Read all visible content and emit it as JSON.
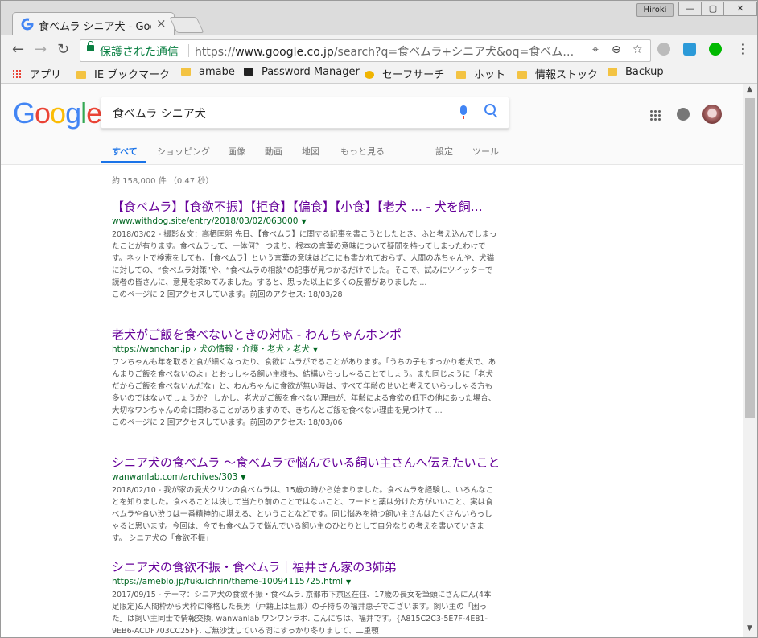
{
  "window": {
    "tab_title": "食べムラ シニア犬 - Goo",
    "profile": "Hiroki",
    "min": "—",
    "max": "▢",
    "close": "✕"
  },
  "toolbar": {
    "back": "←",
    "forward": "→",
    "reload": "C",
    "secure_label": "保護された通信",
    "url_scheme": "https://",
    "url_host": "www.google.co.jp",
    "url_rest": "/search?q=食べムラ+シニア犬&oq=食べム…",
    "menu": "⋮"
  },
  "bookmarks": [
    {
      "label": "アプリ"
    },
    {
      "label": "IE ブックマーク"
    },
    {
      "label": "amabe"
    },
    {
      "label": "Password Manager"
    },
    {
      "label": "セーフサーチ"
    },
    {
      "label": "ホット"
    },
    {
      "label": "情報ストック"
    },
    {
      "label": "Backup"
    }
  ],
  "google": {
    "logo": [
      "G",
      "o",
      "o",
      "g",
      "l",
      "e"
    ],
    "logo_colors": [
      "#4285f4",
      "#ea4335",
      "#fbbc05",
      "#4285f4",
      "#34a853",
      "#ea4335"
    ],
    "query": "食べムラ シニア犬",
    "tabs": [
      "すべて",
      "ショッピング",
      "画像",
      "動画",
      "地図",
      "もっと見る"
    ],
    "tools": [
      "設定",
      "ツール"
    ],
    "stats": "約 158,000 件 （0.47 秒）"
  },
  "results": [
    {
      "title": "【食べムラ】【食欲不振】【拒食】【偏食】【小食】【老犬 ... - 犬を飼…",
      "url": "www.withdog.site/entry/2018/03/02/063000",
      "snippet": "2018/03/02 - 撮影＆文：高栖匡躬 先日、【食べムラ】に関する記事を書こうとしたとき、ふと考え込んでしまったことが有ります。食べムラって、一体何？ つまり、根本の言葉の意味について疑問を持ってしまったわけです。ネットで検索をしても、【食べムラ】という言葉の意味はどこにも書かれておらず、人間の赤ちゃんや、犬猫に対しての、“食べムラ対策”や、“食べムラの相談”の記事が見つかるだけでした。そこで、試みにツイッターで読者の皆さんに、意見を求めてみました。すると、思った以上に多くの反響がありました ...",
      "visited": "このページに 2 回アクセスしています。前回のアクセス: 18/03/28"
    },
    {
      "title": "老犬がご飯を食べないときの対応 - わんちゃんホンポ",
      "url": "https://wanchan.jp › 犬の情報 › 介護・老犬 › 老犬",
      "snippet": "ワンちゃんも年を取ると食が細くなったり、食欲にムラがでることがあります。「うちの子もすっかり老犬で、あんまりご飯を食べないのよ」とおっしゃる飼い主様も、結構いらっしゃることでしょう。また同じように「老犬だからご飯を食べないんだな」と、わんちゃんに食欲が無い時は、すべて年齢のせいと考えていらっしゃる方も多いのではないでしょうか？ しかし、老犬がご飯を食べない理由が、年齢による食欲の低下の他にあった場合、大切なワンちゃんの命に関わることがありますので、きちんとご飯を食べない理由を見つけて ...",
      "visited": "このページに 2 回アクセスしています。前回のアクセス: 18/03/06"
    },
    {
      "title": "シニア犬の食べムラ 〜食べムラで悩んでいる飼い主さんへ伝えたいこと…",
      "url": "wanwanlab.com/archives/303",
      "snippet": "2018/02/10 - 我が家の愛犬クリンの食べムラは、15歳の時から始まりました。食べムラを経験し、いろんなことを知りました。食べることは決して当たり前のことではないこと、フードと薬は分けた方がいいこと、実は食べムラや食い渋りは一番精神的に堪える、ということなどです。同じ悩みを持つ飼い主さんはたくさんいらっしゃると思います。今回は、今でも食べムラで悩んでいる飼い主のひとりとして自分なりの考えを書いていきます。 シニア犬の「食欲不振」",
      "visited": ""
    },
    {
      "title": "シニア犬の食欲不振・食べムラ｜福井さん家の3姉弟",
      "url": "https://ameblo.jp/fukuichrin/theme-10094115725.html",
      "snippet": "2017/09/15 - テーマ：シニア犬の食欲不振・食べムラ. 京都市下京区在住、17歳の長女を筆頭にさんにん(4本足限定)&人間枠から犬枠に降格した長男（戸籍上は旦那）の子持ちの福井惠子でございます。飼い主の「困った」は飼い主同士で情報交換. wanwanlab ワンワンラボ. こんにちは、福井です。{A815C2C3-5E7F-4E81-9EB6-ACDF703CC25F}. ご無沙汰している間にすっかり冬りまして、二重顎",
      "visited": ""
    }
  ]
}
